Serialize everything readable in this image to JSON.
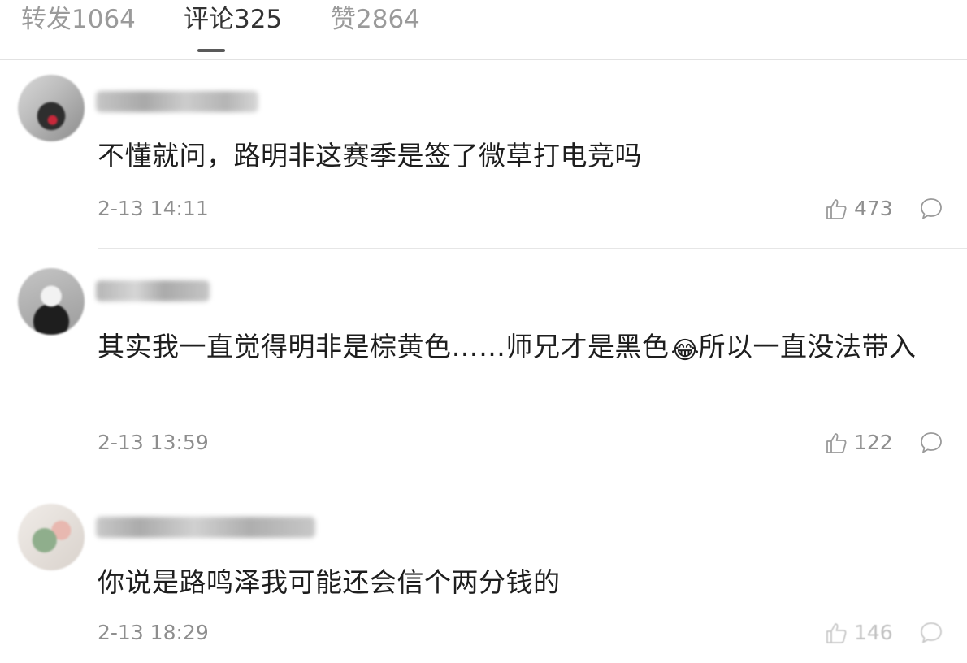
{
  "tabs": [
    {
      "label": "转发1064",
      "active": false
    },
    {
      "label": "评论325",
      "active": true
    },
    {
      "label": "赞2864",
      "active": false
    }
  ],
  "comments": [
    {
      "text": "不懂就问，路明非这赛季是签了微草打电竞吗",
      "time": "2-13 14:11",
      "likes": "473"
    },
    {
      "text_before": "其实我一直觉得明非是棕黄色……师兄才是黑色",
      "emoji": "😂",
      "text_after": "所以一直没法带入",
      "time": "2-13 13:59",
      "likes": "122"
    },
    {
      "text": "你说是路鸣泽我可能还会信个两分钱的",
      "time": "2-13 18:29",
      "likes": "146"
    }
  ],
  "icons": {
    "like": "thumbs-up-icon",
    "reply": "speech-bubble-icon"
  },
  "colors": {
    "text": "#1e1e1e",
    "meta": "#8e8e8e",
    "tab_inactive": "#9a9a9a",
    "tab_active": "#333333"
  }
}
